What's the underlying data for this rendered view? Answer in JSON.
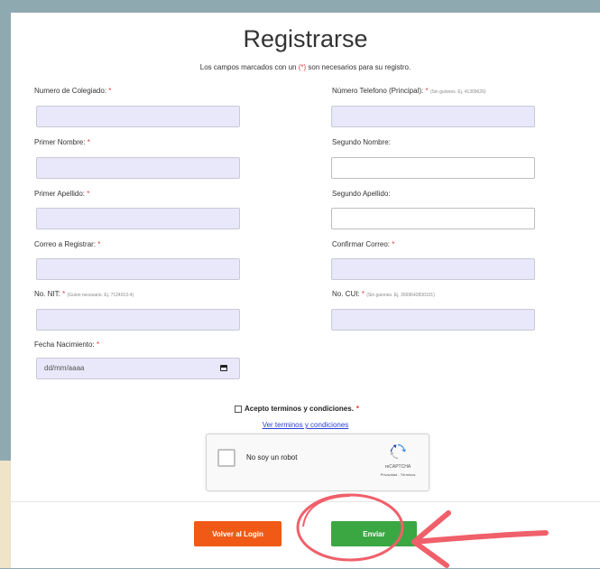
{
  "form": {
    "title": "Registrarse",
    "subtitle_before": "Los campos marcados con un ",
    "subtitle_mark": "(*)",
    "subtitle_after": " son necesarios para su registro.",
    "required_mark": "*",
    "fields": {
      "numero_colegiado": {
        "label": "Numero de Colegiado:"
      },
      "telefono": {
        "label": "Número Telefono (Principal):",
        "hint": "(Sin guiones. Ej. 41309626)"
      },
      "primer_nombre": {
        "label": "Primer Nombre:"
      },
      "segundo_nombre": {
        "label": "Segundo Nombre:"
      },
      "primer_apellido": {
        "label": "Primer Apellido:"
      },
      "segundo_apellido": {
        "label": "Segundo Apellido:"
      },
      "correo": {
        "label": "Correo a Registrar:"
      },
      "confirmar_correo": {
        "label": "Confirmar Correo:"
      },
      "nit": {
        "label": "No. NIT:",
        "hint": "(Guion necesario. Ej. 7124013-4)"
      },
      "cui": {
        "label": "No. CUI:",
        "hint": "(Sin guiones. Ej. 2669642830101)"
      },
      "fecha_nacimiento": {
        "label": "Fecha Nacimiento:",
        "placeholder": "dd/mm/aaaa"
      }
    },
    "terms_label": "Acepto terminos y condiciones.",
    "terms_link": "Ver terminos y condiciones",
    "recaptcha": {
      "label": "No soy un robot",
      "brand": "reCAPTCHA",
      "links": "Privacidad - Términos"
    },
    "buttons": {
      "back": "Volver al Login",
      "submit": "Enviar"
    }
  },
  "colors": {
    "page_bg": "#8fa9b0",
    "required": "#e23b3b",
    "back_button": "#f05a16",
    "submit_button": "#3aa743",
    "annotation": "#f0606a",
    "link": "#2b3fd6"
  },
  "icons": [
    "calendar-icon",
    "checkbox-icon",
    "recaptcha-logo-icon",
    "arrow-annotation-icon"
  ]
}
